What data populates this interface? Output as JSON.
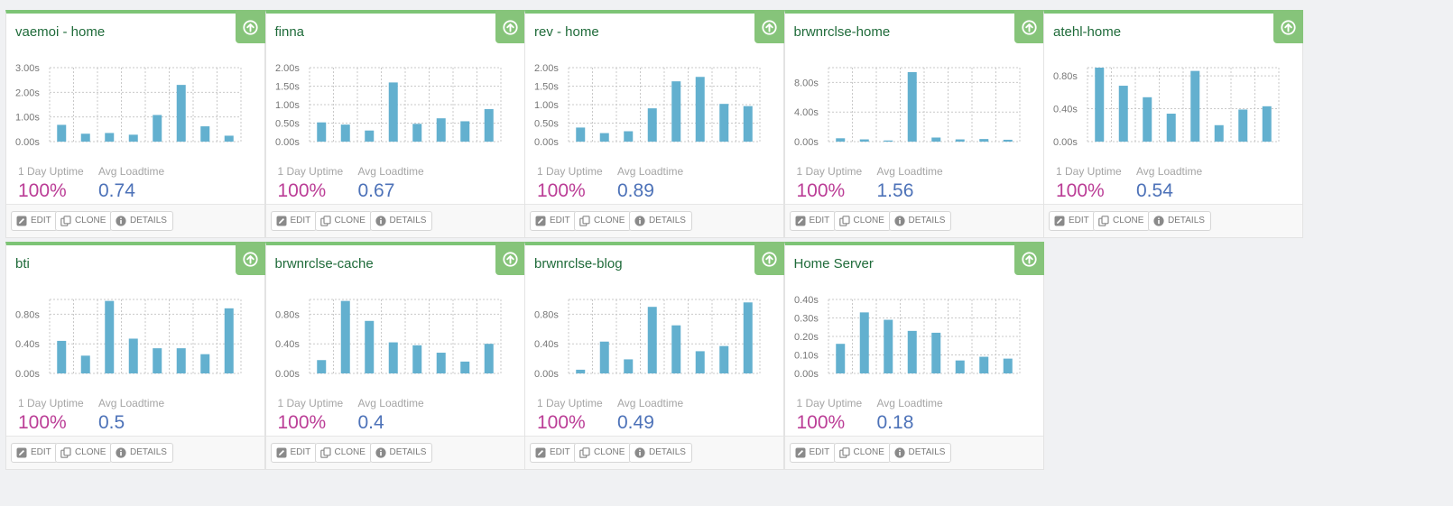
{
  "buttons": {
    "edit": "EDIT",
    "clone": "CLONE",
    "details": "DETAILS"
  },
  "labels": {
    "uptime": "1 Day Uptime",
    "loadtime": "Avg Loadtime"
  },
  "colors": {
    "bar": "#63b0cf",
    "header_green": "#7dc476",
    "title": "#1f6b3a",
    "uptime": "#bb3d96",
    "loadtime": "#4d72b8"
  },
  "icons": {
    "status": "arrow-up-circle-icon",
    "edit": "pencil-icon",
    "clone": "copy-icon",
    "details": "info-icon"
  },
  "monitors": [
    {
      "title": "vaemoi - home",
      "uptime": "100%",
      "loadtime": "0.74",
      "chart_data": {
        "type": "bar",
        "ticks": [
          "3.00s",
          "2.00s",
          "1.00s",
          "0.00s"
        ],
        "ylim": [
          0,
          3.0
        ],
        "values": [
          0.68,
          0.32,
          0.35,
          0.28,
          1.08,
          2.3,
          0.62,
          0.24
        ]
      }
    },
    {
      "title": "finna",
      "uptime": "100%",
      "loadtime": "0.67",
      "chart_data": {
        "type": "bar",
        "ticks": [
          "2.00s",
          "1.50s",
          "1.00s",
          "0.50s",
          "0.00s"
        ],
        "ylim": [
          0,
          2.0
        ],
        "values": [
          0.52,
          0.46,
          0.3,
          1.6,
          0.48,
          0.63,
          0.55,
          0.88
        ]
      }
    },
    {
      "title": "rev - home",
      "uptime": "100%",
      "loadtime": "0.89",
      "chart_data": {
        "type": "bar",
        "ticks": [
          "2.00s",
          "1.50s",
          "1.00s",
          "0.50s",
          "0.00s"
        ],
        "ylim": [
          0,
          2.0
        ],
        "values": [
          0.38,
          0.23,
          0.28,
          0.9,
          1.63,
          1.75,
          1.02,
          0.96
        ]
      }
    },
    {
      "title": "brwnrclse-home",
      "uptime": "100%",
      "loadtime": "1.56",
      "chart_data": {
        "type": "bar",
        "ticks": [
          "8.00s",
          "4.00s",
          "0.00s"
        ],
        "ylim": [
          0,
          10.0
        ],
        "values": [
          0.45,
          0.3,
          0.15,
          9.4,
          0.55,
          0.3,
          0.35,
          0.25
        ]
      }
    },
    {
      "title": "atehl-home",
      "uptime": "100%",
      "loadtime": "0.54",
      "chart_data": {
        "type": "bar",
        "ticks": [
          "0.80s",
          "0.40s",
          "0.00s"
        ],
        "ylim": [
          0,
          0.9
        ],
        "values": [
          0.9,
          0.68,
          0.54,
          0.34,
          0.86,
          0.2,
          0.39,
          0.43
        ]
      }
    },
    {
      "title": "bti",
      "uptime": "100%",
      "loadtime": "0.5",
      "chart_data": {
        "type": "bar",
        "ticks": [
          "0.80s",
          "0.40s",
          "0.00s"
        ],
        "ylim": [
          0,
          1.0
        ],
        "values": [
          0.44,
          0.24,
          0.98,
          0.47,
          0.34,
          0.34,
          0.26,
          0.88
        ]
      }
    },
    {
      "title": "brwnrclse-cache",
      "uptime": "100%",
      "loadtime": "0.4",
      "chart_data": {
        "type": "bar",
        "ticks": [
          "0.80s",
          "0.40s",
          "0.00s"
        ],
        "ylim": [
          0,
          1.0
        ],
        "values": [
          0.18,
          0.98,
          0.71,
          0.42,
          0.38,
          0.28,
          0.16,
          0.4
        ]
      }
    },
    {
      "title": "brwnrclse-blog",
      "uptime": "100%",
      "loadtime": "0.49",
      "chart_data": {
        "type": "bar",
        "ticks": [
          "0.80s",
          "0.40s",
          "0.00s"
        ],
        "ylim": [
          0,
          1.0
        ],
        "values": [
          0.05,
          0.43,
          0.19,
          0.9,
          0.65,
          0.3,
          0.37,
          0.96
        ]
      }
    },
    {
      "title": "Home Server",
      "uptime": "100%",
      "loadtime": "0.18",
      "chart_data": {
        "type": "bar",
        "ticks": [
          "0.40s",
          "0.30s",
          "0.20s",
          "0.10s",
          "0.00s"
        ],
        "ylim": [
          0,
          0.4
        ],
        "values": [
          0.16,
          0.33,
          0.29,
          0.23,
          0.22,
          0.07,
          0.09,
          0.08
        ]
      }
    }
  ]
}
